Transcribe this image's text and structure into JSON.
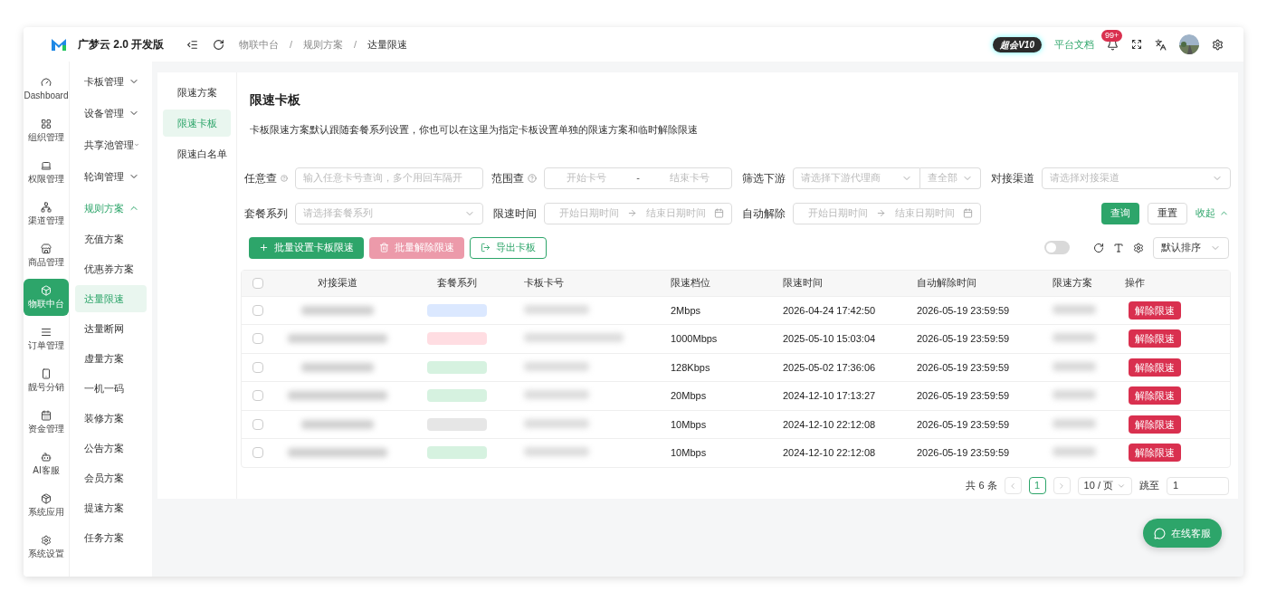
{
  "app": {
    "logo_text": "广梦云 2.0 开发版"
  },
  "rail": [
    {
      "label": "Dashboard",
      "selected": false
    },
    {
      "label": "组织管理",
      "selected": false
    },
    {
      "label": "权限管理",
      "selected": false
    },
    {
      "label": "渠道管理",
      "selected": false
    },
    {
      "label": "商品管理",
      "selected": false
    },
    {
      "label": "物联中台",
      "selected": true
    },
    {
      "label": "订单管理",
      "selected": false
    },
    {
      "label": "靓号分销",
      "selected": false
    },
    {
      "label": "资金管理",
      "selected": false
    },
    {
      "label": "AI客服",
      "selected": false
    },
    {
      "label": "系统应用",
      "selected": false
    },
    {
      "label": "系统设置",
      "selected": false
    }
  ],
  "submenu": [
    {
      "label": "卡板管理",
      "expanded": false
    },
    {
      "label": "设备管理",
      "expanded": false
    },
    {
      "label": "共享池管理",
      "expanded": false
    },
    {
      "label": "轮询管理",
      "expanded": false
    },
    {
      "label": "规则方案",
      "expanded": true,
      "children": [
        {
          "label": "充值方案",
          "selected": false
        },
        {
          "label": "优惠券方案",
          "selected": false
        },
        {
          "label": "达量限速",
          "selected": true
        },
        {
          "label": "达量断网",
          "selected": false
        },
        {
          "label": "虚量方案",
          "selected": false
        },
        {
          "label": "一机一码",
          "selected": false
        },
        {
          "label": "装修方案",
          "selected": false
        },
        {
          "label": "公告方案",
          "selected": false
        },
        {
          "label": "会员方案",
          "selected": false
        },
        {
          "label": "提速方案",
          "selected": false
        },
        {
          "label": "任务方案",
          "selected": false
        }
      ]
    }
  ],
  "header": {
    "breadcrumbs": [
      "物联中台",
      "规则方案",
      "达量限速"
    ],
    "separator": "/",
    "vip_badge": "超会V10",
    "docs_link": "平台文档",
    "notification_count": "99+"
  },
  "tabs": [
    {
      "label": "限速方案",
      "selected": false
    },
    {
      "label": "限速卡板",
      "selected": true
    },
    {
      "label": "限速白名单",
      "selected": false
    }
  ],
  "page": {
    "title": "限速卡板",
    "description": "卡板限速方案默认跟随套餐系列设置，你也可以在这里为指定卡板设置单独的限速方案和临时解除限速"
  },
  "filters": [
    [
      {
        "kind": "text",
        "label": "任意查",
        "help": true,
        "placeholder": "输入任意卡号查询，多个用回车隔开"
      },
      {
        "kind": "range",
        "label": "范围查",
        "help": true,
        "from": "开始卡号",
        "separator": "-",
        "to": "结束卡号"
      },
      {
        "kind": "select_pair",
        "label": "筛选下游",
        "placeholder": "请选择下游代理商",
        "value": "查全部"
      },
      {
        "kind": "select",
        "label": "对接渠道",
        "placeholder": "请选择对接渠道"
      }
    ],
    [
      {
        "kind": "select",
        "label": "套餐系列",
        "placeholder": "请选择套餐系列"
      },
      {
        "kind": "date_range",
        "label": "限速时间",
        "from": "开始日期时间",
        "to": "结束日期时间"
      },
      {
        "kind": "date_range",
        "label": "自动解除",
        "from": "开始日期时间",
        "to": "结束日期时间"
      }
    ]
  ],
  "filter_buttons": {
    "search": "查询",
    "reset": "重置",
    "collapse": "收起"
  },
  "actions": [
    {
      "label": "批量设置卡板限速",
      "kind": "add",
      "disabled": false
    },
    {
      "label": "批量解除限速",
      "kind": "delete",
      "disabled": true
    },
    {
      "label": "导出卡板",
      "kind": "export",
      "disabled": false
    }
  ],
  "toolbar": {
    "toggle_on": false,
    "sort": "默认排序"
  },
  "table": {
    "all_checked": false,
    "columns": [
      "对接渠道",
      "套餐系列",
      "卡板卡号",
      "限速档位",
      "限速时间",
      "自动解除时间",
      "限速方案",
      "操作"
    ],
    "rows": [
      {
        "checked": false,
        "color": "#dbe8ff",
        "speed": "2Mbps",
        "limit_time": "2026-04-24 17:42:50",
        "release_time": "2026-05-19 23:59:59",
        "action": "解除限速"
      },
      {
        "checked": false,
        "color": "#ffdde2",
        "speed": "1000Mbps",
        "limit_time": "2025-05-10 15:03:04",
        "release_time": "2026-05-19 23:59:59",
        "action": "解除限速"
      },
      {
        "checked": false,
        "color": "#d6f2e0",
        "speed": "128Kbps",
        "limit_time": "2025-05-02 17:36:06",
        "release_time": "2026-05-19 23:59:59",
        "action": "解除限速"
      },
      {
        "checked": false,
        "color": "#d6f2e0",
        "speed": "20Mbps",
        "limit_time": "2024-12-10 17:13:27",
        "release_time": "2026-05-19 23:59:59",
        "action": "解除限速"
      },
      {
        "checked": false,
        "color": "#e6e6e6",
        "speed": "10Mbps",
        "limit_time": "2024-12-10 22:12:08",
        "release_time": "2026-05-19 23:59:59",
        "action": "解除限速"
      },
      {
        "checked": false,
        "color": "#d6f2e0",
        "speed": "10Mbps",
        "limit_time": "2024-12-10 22:12:08",
        "release_time": "2026-05-19 23:59:59",
        "action": "解除限速"
      }
    ]
  },
  "pagination": {
    "total": "共 6 条",
    "pages": [
      {
        "label": "1",
        "selected": true
      }
    ],
    "page_size": "10 / 页",
    "jump_label": "跳至",
    "jump_value": "1"
  },
  "support_button": "在线客服"
}
